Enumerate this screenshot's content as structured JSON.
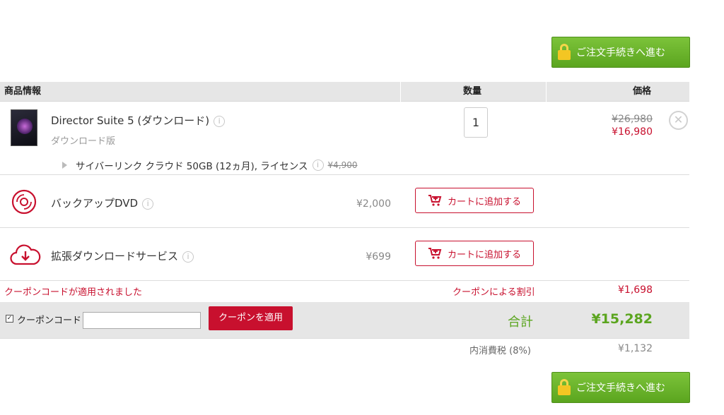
{
  "checkout_button": {
    "label": "ご注文手続きへ進む"
  },
  "table_header": {
    "product": "商品情報",
    "quantity": "数量",
    "price": "価格"
  },
  "product": {
    "title": "Director Suite 5 (ダウンロード)",
    "subtitle": "ダウンロード版",
    "quantity": "1",
    "price_original": "¥26,980",
    "price_sale": "¥16,980",
    "addon": {
      "label": "サイバーリンク クラウド 50GB (12ヵ月), ライセンス",
      "price_original": "¥4,900"
    }
  },
  "upsells": [
    {
      "title": "バックアップDVD",
      "price": "¥2,000",
      "button": "カートに追加する",
      "icon": "disc-icon"
    },
    {
      "title": "拡張ダウンロードサービス",
      "price": "¥699",
      "button": "カートに追加する",
      "icon": "cloud-download-icon"
    }
  ],
  "coupon": {
    "applied_message": "クーポンコードが適用されました",
    "discount_label": "クーポンによる割引",
    "discount_value": "¥1,698",
    "label": "クーポンコード",
    "checked": true,
    "input_value": "",
    "apply_button": "クーポンを適用"
  },
  "total": {
    "label": "合計",
    "value": "¥15,282"
  },
  "tax": {
    "label": "内消費税 (8%)",
    "value": "¥1,132"
  },
  "colors": {
    "green": "#5ba51f",
    "red": "#c8102e",
    "header_bg": "#e6e6e6"
  },
  "info_icon": "i"
}
